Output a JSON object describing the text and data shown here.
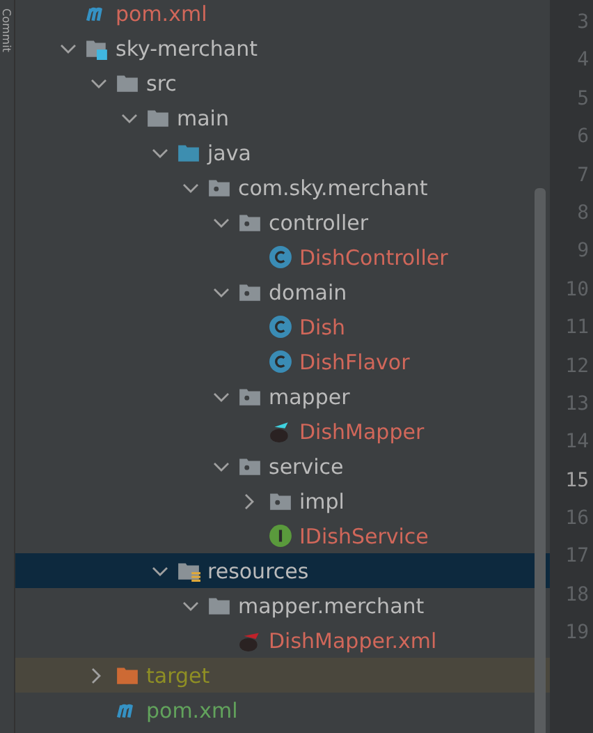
{
  "side_tab": {
    "label": "Commit"
  },
  "tree": [
    {
      "label": "pom.xml",
      "kind": "maven",
      "color": "#d1675a",
      "selected": false
    },
    {
      "label": "sky-merchant",
      "kind": "module",
      "color": "#bbbbbb",
      "selected": false,
      "expanded": true,
      "children": [
        {
          "label": "src",
          "kind": "folder",
          "color": "#bbbbbb",
          "selected": false,
          "expanded": true,
          "children": [
            {
              "label": "main",
              "kind": "folder",
              "color": "#bbbbbb",
              "selected": false,
              "expanded": true,
              "children": [
                {
                  "label": "java",
                  "kind": "source",
                  "color": "#bbbbbb",
                  "selected": false,
                  "expanded": true,
                  "children": [
                    {
                      "label": "com.sky.merchant",
                      "kind": "package",
                      "color": "#bbbbbb",
                      "selected": false,
                      "expanded": true,
                      "children": [
                        {
                          "label": "controller",
                          "kind": "package",
                          "color": "#bbbbbb",
                          "selected": false,
                          "expanded": true,
                          "children": [
                            {
                              "label": "DishController",
                              "kind": "class",
                              "color": "#d1675a",
                              "selected": false
                            }
                          ]
                        },
                        {
                          "label": "domain",
                          "kind": "package",
                          "color": "#bbbbbb",
                          "selected": false,
                          "expanded": true,
                          "children": [
                            {
                              "label": "Dish",
                              "kind": "class",
                              "color": "#d1675a",
                              "selected": false
                            },
                            {
                              "label": "DishFlavor",
                              "kind": "class",
                              "color": "#d1675a",
                              "selected": false
                            }
                          ]
                        },
                        {
                          "label": "mapper",
                          "kind": "package",
                          "color": "#bbbbbb",
                          "selected": false,
                          "expanded": true,
                          "children": [
                            {
                              "label": "DishMapper",
                              "kind": "mapper",
                              "color": "#d1675a",
                              "selected": false
                            }
                          ]
                        },
                        {
                          "label": "service",
                          "kind": "package",
                          "color": "#bbbbbb",
                          "selected": false,
                          "expanded": true,
                          "children": [
                            {
                              "label": "impl",
                              "kind": "package",
                              "color": "#bbbbbb",
                              "selected": false,
                              "expanded": false
                            },
                            {
                              "label": "IDishService",
                              "kind": "interface",
                              "color": "#d1675a",
                              "selected": false
                            }
                          ]
                        }
                      ]
                    }
                  ]
                },
                {
                  "label": "resources",
                  "kind": "resources",
                  "color": "#bbbbbb",
                  "selected": true,
                  "expanded": true,
                  "children": [
                    {
                      "label": "mapper.merchant",
                      "kind": "folder",
                      "color": "#bbbbbb",
                      "selected": false,
                      "expanded": true,
                      "children": [
                        {
                          "label": "DishMapper.xml",
                          "kind": "mapperxml",
                          "color": "#d1675a",
                          "selected": false
                        }
                      ]
                    }
                  ]
                }
              ]
            }
          ]
        },
        {
          "label": "target",
          "kind": "excluded",
          "color": "#8f8f24",
          "selected": false,
          "expanded": false
        },
        {
          "label": "pom.xml",
          "kind": "maven",
          "color": "#62a35c",
          "selected": false
        }
      ]
    }
  ],
  "line_numbers": [
    {
      "number": "3",
      "current": false
    },
    {
      "number": "4",
      "current": false
    },
    {
      "number": "5",
      "current": false
    },
    {
      "number": "6",
      "current": false
    },
    {
      "number": "7",
      "current": false
    },
    {
      "number": "8",
      "current": false
    },
    {
      "number": "9",
      "current": false
    },
    {
      "number": "10",
      "current": false
    },
    {
      "number": "11",
      "current": false
    },
    {
      "number": "12",
      "current": false
    },
    {
      "number": "13",
      "current": false
    },
    {
      "number": "14",
      "current": false
    },
    {
      "number": "15",
      "current": true
    },
    {
      "number": "16",
      "current": false
    },
    {
      "number": "17",
      "current": false
    },
    {
      "number": "18",
      "current": false
    },
    {
      "number": "19",
      "current": false
    }
  ]
}
